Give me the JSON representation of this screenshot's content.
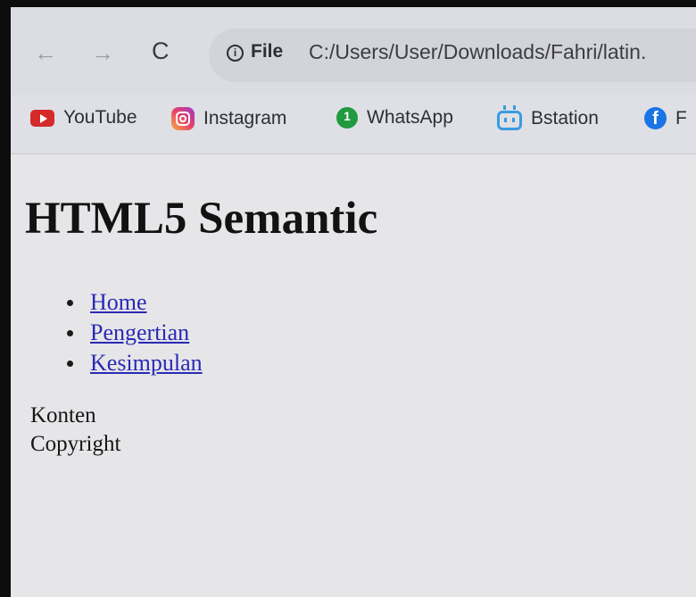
{
  "browser": {
    "back_icon": "←",
    "forward_icon": "→",
    "reload_icon": "C",
    "info_icon": "i",
    "scheme_label": "File",
    "url": "C:/Users/User/Downloads/Fahri/latin."
  },
  "bookmarks": [
    {
      "label": "YouTube",
      "icon": "youtube-icon"
    },
    {
      "label": "Instagram",
      "icon": "instagram-icon"
    },
    {
      "label": "WhatsApp",
      "icon": "whatsapp-icon"
    },
    {
      "label": "Bstation",
      "icon": "bstation-icon"
    },
    {
      "label": "F",
      "icon": "facebook-icon"
    }
  ],
  "page": {
    "heading": "HTML5 Semantic",
    "nav": [
      {
        "label": "Home"
      },
      {
        "label": "Pengertian"
      },
      {
        "label": "Kesimpulan"
      }
    ],
    "content_text": "Konten",
    "footer_text": "Copyright"
  },
  "colors": {
    "link": "#2a2ab4",
    "youtube": "#d42a2a",
    "whatsapp": "#1f9a3e",
    "bstation": "#3b9be0",
    "facebook": "#1b74e4"
  }
}
